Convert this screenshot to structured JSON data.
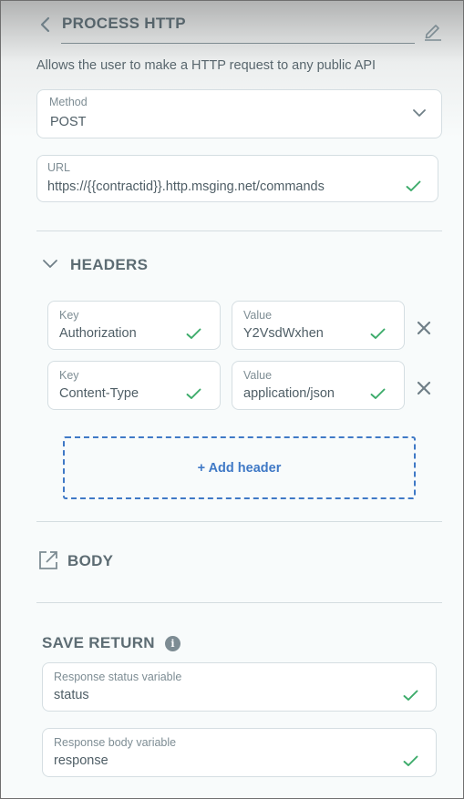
{
  "header": {
    "title": "PROCESS HTTP",
    "back_icon": "chevron-left-icon",
    "edit_icon": "pencil-icon"
  },
  "description": "Allows the user to make a HTTP request to any public API",
  "method": {
    "label": "Method",
    "value": "POST",
    "icon": "chevron-down-icon"
  },
  "url": {
    "label": "URL",
    "value": "https://{{contractid}}.http.msging.net/commands"
  },
  "headers_section": {
    "title": "HEADERS",
    "rows": [
      {
        "key_label": "Key",
        "key_value": "Authorization",
        "value_label": "Value",
        "value_value": "Y2VsdWxhen"
      },
      {
        "key_label": "Key",
        "key_value": "Content-Type",
        "value_label": "Value",
        "value_value": "application/json"
      }
    ],
    "add_label": "+ Add header"
  },
  "body_section": {
    "title": "BODY",
    "icon": "external-link-icon"
  },
  "save_return": {
    "title": "SAVE RETURN",
    "fields": [
      {
        "label": "Response status variable",
        "value": "status"
      },
      {
        "label": "Response body variable",
        "value": "response"
      }
    ]
  },
  "colors": {
    "accent_blue": "#3f79c6",
    "check_green": "#3cab6a",
    "text": "#52636c"
  }
}
